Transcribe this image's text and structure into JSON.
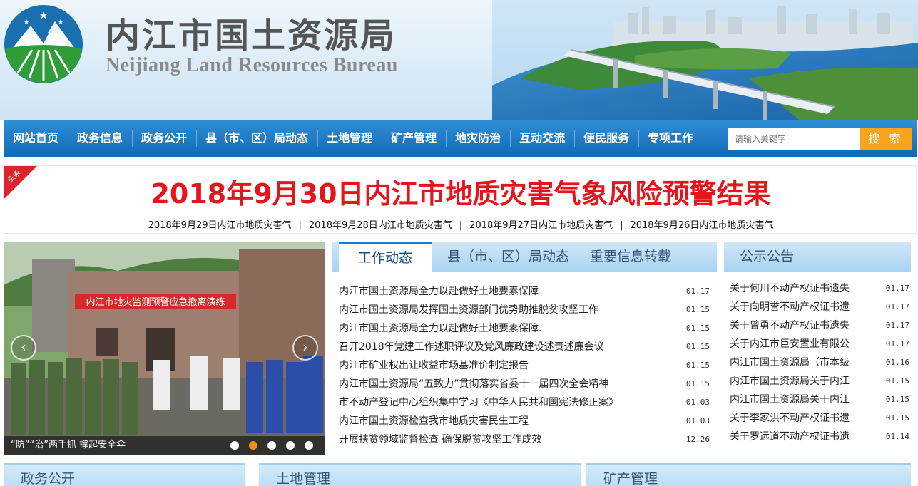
{
  "site": {
    "title": "内江市国土资源局",
    "subtitle": "Neijiang Land Resources Bureau"
  },
  "nav": {
    "items": [
      "网站首页",
      "政务信息",
      "政务公开",
      "县（市、区）局动态",
      "土地管理",
      "矿产管理",
      "地灾防治",
      "互动交流",
      "便民服务",
      "专项工作"
    ],
    "search_placeholder": "请输入关键字",
    "search_label": "搜 索"
  },
  "headline": {
    "corner_label": "头条",
    "title": "2018年9月30日内江市地质灾害气象风险预警结果",
    "links": [
      "2018年9月29日内江市地质灾害气",
      "2018年9月28日内江市地质灾害气",
      "2018年9月27日内江市地质灾害气",
      "2018年9月26日内江市地质灾害气"
    ],
    "separator": "|"
  },
  "carousel": {
    "banner_text": "内江市地灾监测预警应急撤离演练",
    "caption": "“防”“治”两手抓 撑起安全伞",
    "dot_count": 5,
    "active_dot": 1
  },
  "news": {
    "tabs": [
      "工作动态",
      "县（市、区）局动态",
      "重要信息转载"
    ],
    "items": [
      {
        "title": "内江市国土资源局全力以赴做好土地要素保障",
        "date": "01.17"
      },
      {
        "title": "内江市国土资源局发挥国土资源部门优势助推脱贫攻坚工作",
        "date": "01.15"
      },
      {
        "title": "内江市国土资源局全力以赴做好土地要素保障.",
        "date": "01.15"
      },
      {
        "title": "召开2018年党建工作述职评议及党风廉政建设述责述廉会议",
        "date": "01.15"
      },
      {
        "title": "内江市矿业权出让收益市场基准价制定报告",
        "date": "01.15"
      },
      {
        "title": "内江市国土资源局“五致力”贯彻落实省委十一届四次全会精神",
        "date": "01.15"
      },
      {
        "title": "市不动产登记中心组织集中学习《中华人民共和国宪法修正案》",
        "date": "01.03"
      },
      {
        "title": "内江市国土资源检查我市地质灾害民生工程",
        "date": "01.03"
      },
      {
        "title": "开展扶贫领域监督检查 确保脱贫攻坚工作成效",
        "date": "12.26"
      }
    ]
  },
  "notice": {
    "title": "公示公告",
    "items": [
      {
        "title": "关于何川不动产权证书遗失",
        "date": "01.17"
      },
      {
        "title": "关于向明誉不动产权证书遗",
        "date": "01.17"
      },
      {
        "title": "关于曾勇不动产权证书遗失",
        "date": "01.17"
      },
      {
        "title": "关于内江市巨安置业有限公",
        "date": "01.17"
      },
      {
        "title": "内江市国土资源局（市本级",
        "date": "01.16"
      },
      {
        "title": "内江市国土资源局关于内江",
        "date": "01.15"
      },
      {
        "title": "内江市国土资源局关于内江",
        "date": "01.15"
      },
      {
        "title": "关于李家洪不动产权证书遗",
        "date": "01.15"
      },
      {
        "title": "关于罗远道不动产权证书遗",
        "date": "01.14"
      }
    ]
  },
  "sections": [
    "政务公开",
    "土地管理",
    "矿产管理"
  ],
  "colors": {
    "nav_blue": "#1a7ad0",
    "headline_red": "#e8141b",
    "search_orange": "#f7a51d",
    "dot_active": "#f28c1a"
  }
}
